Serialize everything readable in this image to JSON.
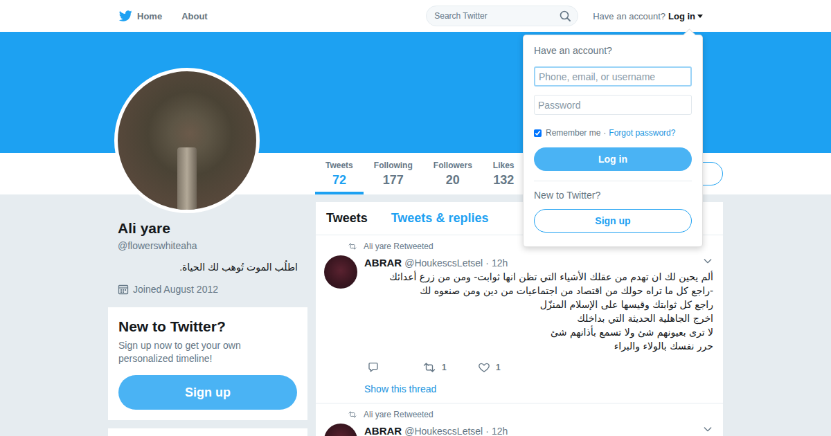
{
  "nav": {
    "home": "Home",
    "about": "About",
    "search": {
      "placeholder": "Search Twitter"
    },
    "account_prompt": "Have an account?",
    "login": "Log in"
  },
  "profile": {
    "name": "Ali yare",
    "handle": "@flowerswhiteaha",
    "bio": "اطلُب الموت تُوهب لك الحياة.",
    "joined": "Joined August 2012"
  },
  "stats": [
    {
      "label": "Tweets",
      "value": "72",
      "selected": true
    },
    {
      "label": "Following",
      "value": "177",
      "selected": false
    },
    {
      "label": "Followers",
      "value": "20",
      "selected": false
    },
    {
      "label": "Likes",
      "value": "132",
      "selected": false
    }
  ],
  "signup_card": {
    "title": "New to Twitter?",
    "text": "Sign up now to get your own personalized timeline!",
    "button": "Sign up"
  },
  "timeline": {
    "tabs": [
      {
        "label": "Tweets",
        "selected": true
      },
      {
        "label": "Tweets & replies",
        "selected": false
      }
    ],
    "tweets": [
      {
        "retweeted_by": "Ali yare Retweeted",
        "name": "ABRAR",
        "handle": "@HoukescsLetsel",
        "dot": "·",
        "time": "12h",
        "paragraphs": [
          "ألم يحين لك ان تهدم من عقلك الأشياء التي تظن انها ثوابت- ومن من زرع أعدائك -راجع كل ما تراه حولك من اقتصاد من اجتماعيات من دين ومن صنعوه لك",
          "راجع كل ثوابتك وقيسها على الإسلام المنزّل",
          "اخرج الجاهلية الحديثة التي بداخلك",
          "لا ترى بعيونهم شئ ولا تسمع بأذانهم شئ",
          "حرر نفسك بالولاء والبراء"
        ],
        "retweets": "1",
        "likes": "1",
        "thread_link": "Show this thread"
      },
      {
        "retweeted_by": "Ali yare Retweeted",
        "name": "ABRAR",
        "handle": "@HoukescsLetsel",
        "dot": "·",
        "time": "12h"
      }
    ]
  },
  "login_menu": {
    "title": "Have an account?",
    "username": {
      "placeholder": "Phone, email, or username",
      "focused": true
    },
    "password": {
      "placeholder": "Password"
    },
    "remember": {
      "label": "Remember me",
      "checked": true
    },
    "separator": "·",
    "forgot": "Forgot password?",
    "login_button": "Log in",
    "signup_prompt": "New to Twitter?",
    "signup_button": "Sign up"
  }
}
